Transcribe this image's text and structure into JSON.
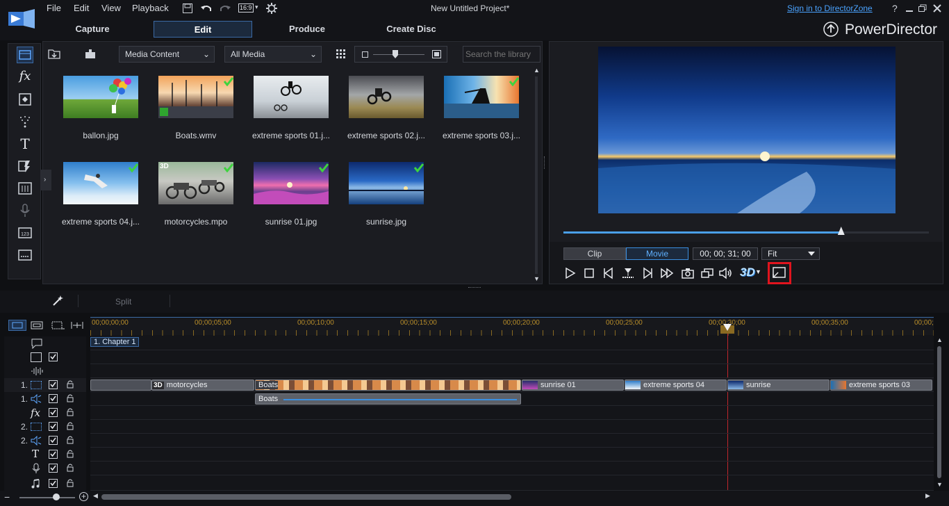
{
  "menu": [
    "File",
    "Edit",
    "View",
    "Playback"
  ],
  "aspect_ratio": "16:9",
  "window_title": "New Untitled Project*",
  "sign_in": "Sign in to DirectorZone",
  "window_controls": {
    "help": "?"
  },
  "modes": [
    {
      "label": "Capture",
      "active": false
    },
    {
      "label": "Edit",
      "active": true
    },
    {
      "label": "Produce",
      "active": false
    },
    {
      "label": "Create Disc",
      "active": false
    }
  ],
  "brand": "PowerDirector",
  "library": {
    "content_dropdown": "Media Content",
    "filter_dropdown": "All Media",
    "search_placeholder": "Search the library",
    "items": [
      {
        "name": "ballon.jpg",
        "checked": false,
        "badge": ""
      },
      {
        "name": "Boats.wmv",
        "checked": true,
        "badge": ""
      },
      {
        "name": "extreme sports 01.j...",
        "checked": false,
        "badge": ""
      },
      {
        "name": "extreme sports 02.j...",
        "checked": false,
        "badge": ""
      },
      {
        "name": "extreme sports 03.j...",
        "checked": true,
        "badge": ""
      },
      {
        "name": "extreme sports 04.j...",
        "checked": true,
        "badge": ""
      },
      {
        "name": "motorcycles.mpo",
        "checked": true,
        "badge": "3D"
      },
      {
        "name": "sunrise 01.jpg",
        "checked": true,
        "badge": ""
      },
      {
        "name": "sunrise.jpg",
        "checked": true,
        "badge": ""
      }
    ]
  },
  "preview": {
    "clip_tab": "Clip",
    "movie_tab": "Movie",
    "timecode": "00; 00; 31; 00",
    "fit": "Fit",
    "threed": "3D",
    "scrubber_position": 0.76
  },
  "toolbar": {
    "split": "Split"
  },
  "timeline": {
    "ruler": [
      "00;00;00;00",
      "00;00;05;00",
      "00;00;10;00",
      "00;00;15;00",
      "00;00;20;00",
      "00;00;25;00",
      "00;00;30;00",
      "00;00;35;00",
      "00;00;"
    ],
    "chapter": "1. Chapter 1",
    "track_labels": {
      "v1": "1.",
      "a1": "1.",
      "v2": "2.",
      "a2": "2."
    },
    "video_clips": [
      {
        "name": "motorcycles",
        "badge": "3D"
      },
      {
        "name": "Boats",
        "badge": ""
      },
      {
        "name": "sunrise 01",
        "badge": ""
      },
      {
        "name": "extreme sports 04",
        "badge": ""
      },
      {
        "name": "sunrise",
        "badge": ""
      },
      {
        "name": "extreme sports 03",
        "badge": ""
      }
    ],
    "audio_clip": "Boats"
  },
  "colors": {
    "accent": "#3b8fe0",
    "check": "#3ed43e",
    "ruler": "#b98e2a",
    "playhead": "#c0262d",
    "highlight": "#e0141e"
  }
}
